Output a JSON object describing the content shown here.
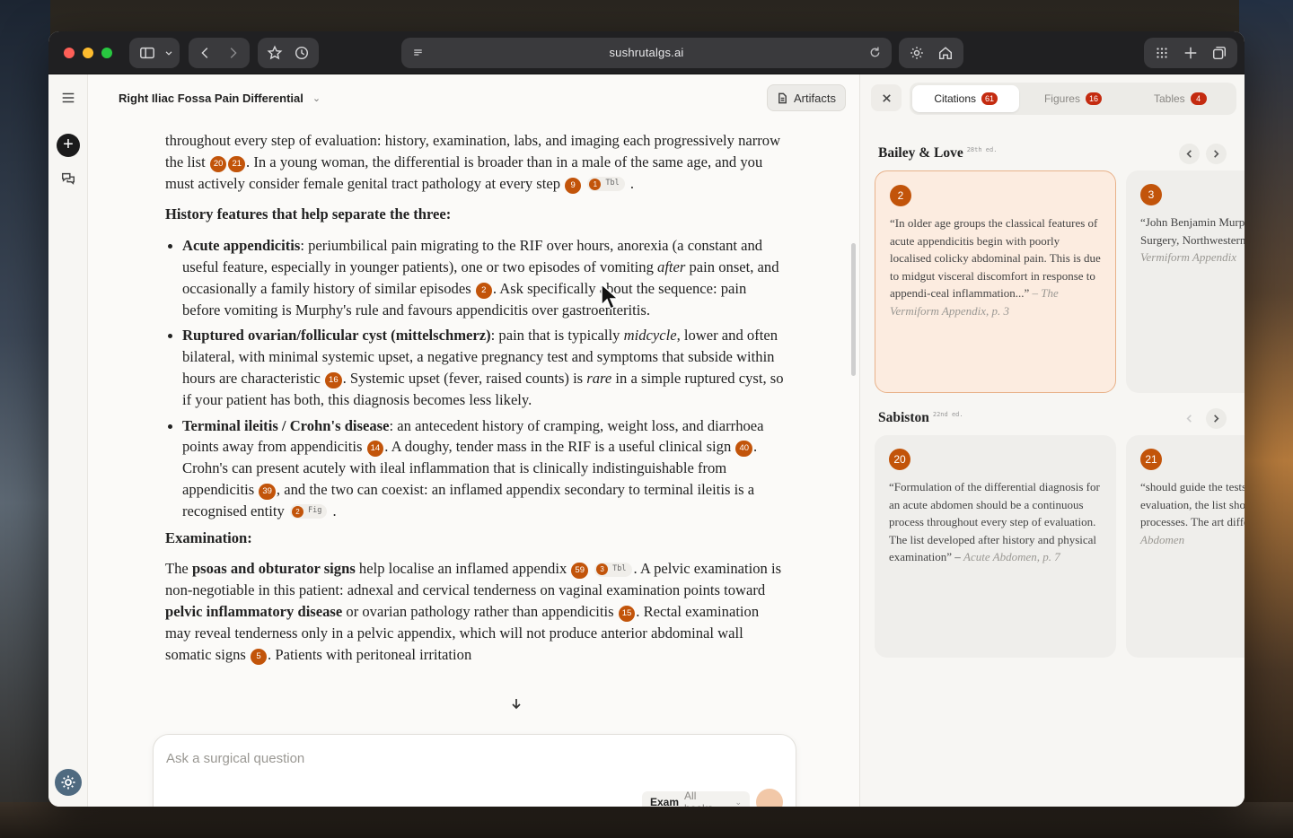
{
  "browser": {
    "url": "sushrutalgs.ai"
  },
  "chat": {
    "title": "Right Iliac Fossa Pain Differential",
    "artifacts_label": "Artifacts",
    "composer_placeholder": "Ask a surgical question",
    "mode_label": "Exam",
    "books_label": "All books"
  },
  "article": {
    "p1a": "throughout every step of evaluation: history, examination, labs, and imaging each progressively narrow the list",
    "p1b": ". In a young woman, the differential is broader than in a male of the same age, and you must actively consider female genital tract pathology at every step",
    "h_history": "History features that help separate the three:",
    "b1_bold": "Acute appendicitis",
    "b1a": ": periumbilical pain migrating to the RIF over hours, anorexia (a constant and useful feature, especially in younger patients), one or two episodes of vomiting ",
    "b1_em": "after",
    "b1b": " pain onset, and occasionally a family history of similar episodes",
    "b1c": ". Ask specifically about the sequence: pain before vomiting is Murphy's rule and favours appendicitis over gastroenteritis.",
    "b2_bold": "Ruptured ovarian/follicular cyst (mittelschmerz)",
    "b2a": ": pain that is typically ",
    "b2_em1": "midcycle",
    "b2b": ", lower and often bilateral, with minimal systemic upset, a negative pregnancy test and symptoms that subside within hours are characteristic",
    "b2c": ". Systemic upset (fever, raised counts) is ",
    "b2_em2": "rare",
    "b2d": " in a simple ruptured cyst, so if your patient has both, this diagnosis becomes less likely.",
    "b3_bold": "Terminal ileitis / Crohn's disease",
    "b3a": ": an antecedent history of cramping, weight loss, and diarrhoea points away from appendicitis",
    "b3b": ". A doughy, tender mass in the RIF is a useful clinical sign",
    "b3c": ". Crohn's can present acutely with ileal inflammation that is clinically indistinguishable from appendicitis",
    "b3d": ", and the two can coexist: an inflamed appendix secondary to terminal ileitis is a recognised entity",
    "h_exam": "Examination:",
    "e1": "The ",
    "e1_bold": "psoas and obturator signs",
    "e2": " help localise an inflamed appendix",
    "e3": ". A pelvic examination is non-negotiable in this patient: adnexal and cervical tenderness on vaginal examination points toward ",
    "e3_bold": "pelvic inflammatory disease",
    "e4": " or ovarian pathology rather than appendicitis",
    "e5": ". Rectal examination may reveal tenderness only in a pelvic appendix, which will not produce anterior abdominal wall somatic signs",
    "e6": ". Patients with peritoneal irritation",
    "cites": {
      "c20": "20",
      "c21": "21",
      "c9": "9",
      "c2": "2",
      "c16": "16",
      "c14": "14",
      "c40": "40",
      "c39": "39",
      "c59": "59",
      "c15": "15",
      "c5": "5"
    },
    "chips": {
      "tbl1": {
        "n": "1",
        "label": "Tbl"
      },
      "fig2": {
        "n": "2",
        "label": "Fig"
      },
      "tbl3": {
        "n": "3",
        "label": "Tbl"
      }
    }
  },
  "panel": {
    "tabs": [
      {
        "label": "Citations",
        "count": "61"
      },
      {
        "label": "Figures",
        "count": "16"
      },
      {
        "label": "Tables",
        "count": "4"
      }
    ],
    "books": [
      {
        "name": "Bailey & Love",
        "edition": "28th ed.",
        "cards": [
          {
            "num": "2",
            "quote": "“In older age groups the classical features of acute appendicitis begin with poorly localised colicky abdominal pain. This is due to midgut visceral discomfort in response to appendi-ceal inflammation...”",
            "source": "– The Vermiform Appendix, p. 3"
          },
          {
            "num": "3",
            "quote": "“John Benjamin Murphy, Professor of Surgery, Northwestern University, Chicago",
            "source": "Vermiform Appendix"
          }
        ]
      },
      {
        "name": "Sabiston",
        "edition": "22nd ed.",
        "cards": [
          {
            "num": "20",
            "quote": "“Formulation of the differential diagnosis for an acute abdomen should be a continuous process throughout every step of evaluation. The list developed after history and physical examination” –",
            "source": "Acute Abdomen, p. 7"
          },
          {
            "num": "21",
            "quote": "“should guide the tests you order. By evaluation, the list should be narrowed processes. The art differential...” –",
            "source": "Acute Abdomen"
          }
        ]
      }
    ]
  },
  "colors": {
    "accent": "#c2540a",
    "badge": "#c42b10",
    "titlebar": "#202022"
  },
  "icons": [
    "sidebar-toggle-icon",
    "back-icon",
    "forward-icon",
    "star-icon",
    "history-icon",
    "reader-icon",
    "reload-icon",
    "settings-icon",
    "home-icon",
    "grid-icon",
    "plus-icon",
    "tabs-icon",
    "menu-icon",
    "new-chat-icon",
    "chats-icon",
    "gear-icon",
    "document-icon",
    "close-icon",
    "chevron-left-icon",
    "chevron-right-icon",
    "arrow-down-icon"
  ]
}
